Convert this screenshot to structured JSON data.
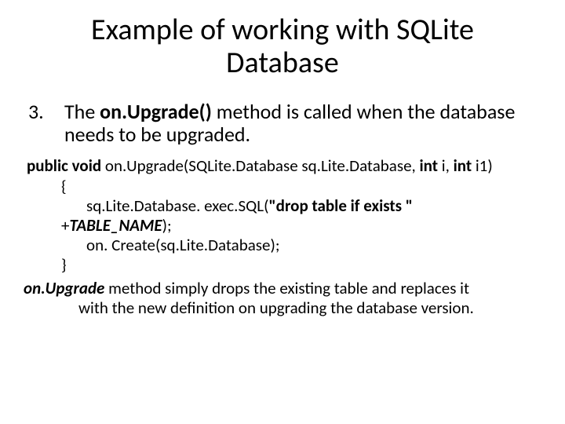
{
  "title_line1": "Example of working with SQLite",
  "title_line2": "Database",
  "bullet_number": "3.",
  "bullet_text_pre": "The ",
  "bullet_method": "on.Upgrade()",
  "bullet_text_post": " method is called when the database needs to be upgraded.",
  "code": {
    "sig_kw1": "public void ",
    "sig_name": "on.Upgrade(SQLite.Database sq.Lite.Database, ",
    "sig_kw2": "int ",
    "sig_i": "i, ",
    "sig_kw3": "int ",
    "sig_i1": "i1)",
    "brace_open": "{",
    "exec_pre": "sq.Lite.Database. exec.SQL(",
    "exec_str": "\"drop table if exists \"",
    "plus": "+",
    "table_name": "TABLE_NAME",
    "close_paren": ");",
    "oncreate": "on. Create(sq.Lite.Database);",
    "brace_close": "}"
  },
  "desc": {
    "method": "on.Upgrade",
    "line1_rest": " method simply drops the existing table and replaces it",
    "line2": "with the new definition on upgrading the database version."
  }
}
